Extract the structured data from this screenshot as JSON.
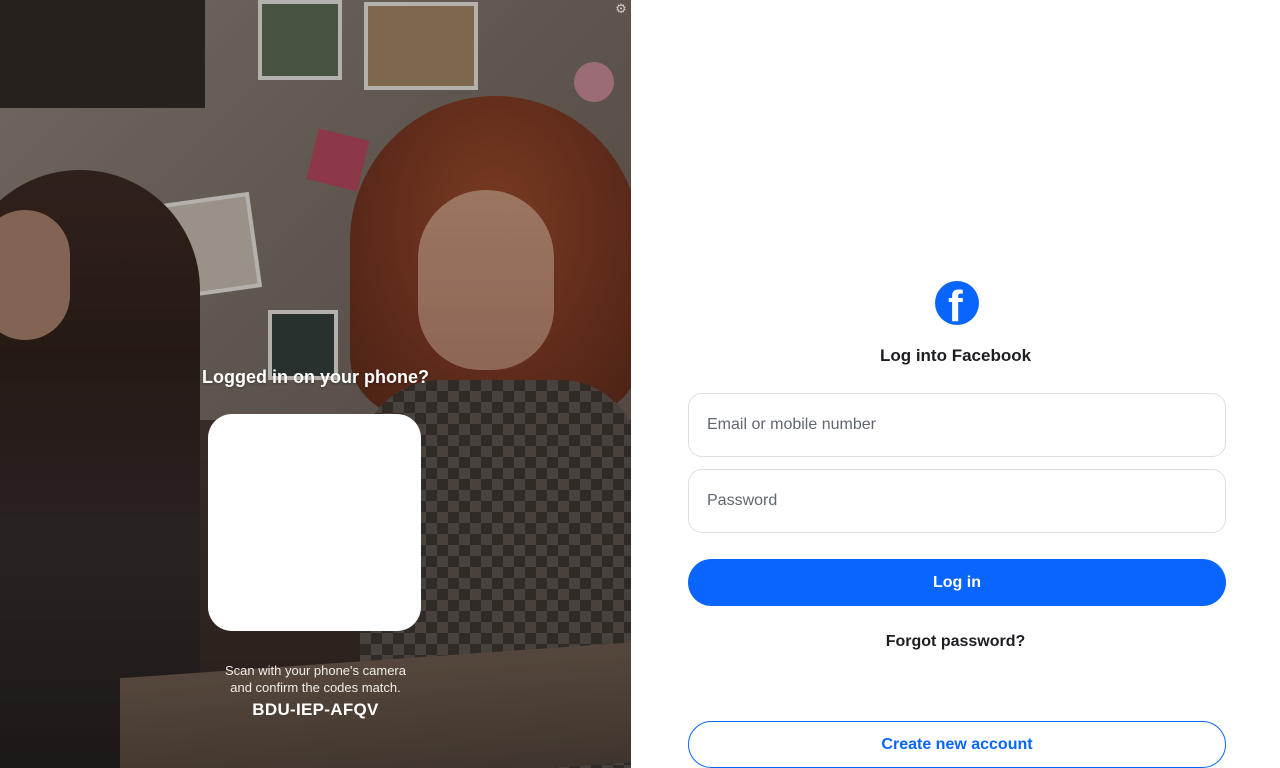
{
  "qr_panel": {
    "title": "Logged in on your phone?",
    "instructions_line1": "Scan with your phone's camera",
    "instructions_line2": "and confirm the codes match.",
    "code": "BDU-IEP-AFQV"
  },
  "login": {
    "logo_icon": "facebook-logo",
    "logo_letter": "f",
    "title": "Log into Facebook",
    "email_placeholder": "Email or mobile number",
    "email_value": "",
    "password_placeholder": "Password",
    "password_value": "",
    "login_label": "Log in",
    "forgot_label": "Forgot password?",
    "create_label": "Create new account"
  },
  "colors": {
    "brand_blue": "#0866ff",
    "text_dark": "#1c1e21",
    "placeholder_gray": "#606770",
    "border_gray": "#dddfe2"
  },
  "icons": {
    "settings": "gear-icon"
  }
}
